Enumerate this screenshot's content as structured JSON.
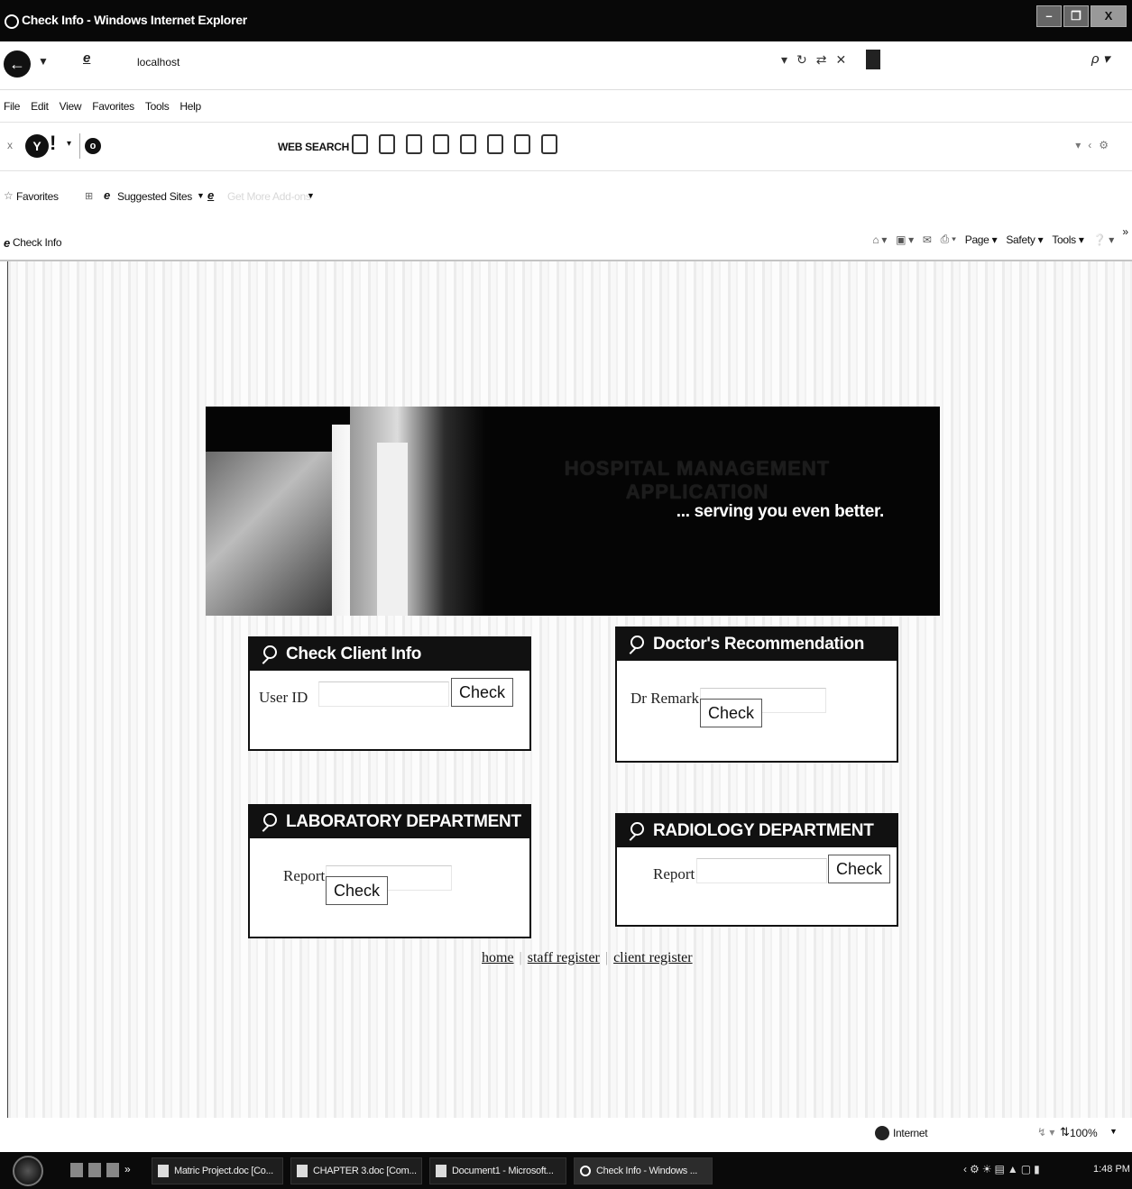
{
  "window": {
    "title": "Check Info - Windows Internet Explorer",
    "minimize_glyph": "–",
    "restore_glyph": "❐",
    "close_glyph": "X"
  },
  "addressbar": {
    "url": "localhost"
  },
  "menu": [
    "File",
    "Edit",
    "View",
    "Favorites",
    "Tools",
    "Help"
  ],
  "toolbar": {
    "websearch_label": "WEB SEARCH"
  },
  "favorites": {
    "favorites_label": "Favorites",
    "suggested_label": "Suggested Sites",
    "webslice_label": "Get More Add-ons"
  },
  "tab": {
    "label": "Check Info"
  },
  "commandbar": {
    "page_label": "Page ▾",
    "safety_label": "Safety ▾",
    "tools_label": "Tools ▾",
    "more_label": "»"
  },
  "banner": {
    "title": "HOSPITAL MANAGEMENT APPLICATION",
    "tagline": "... serving you even better."
  },
  "panels": {
    "client": {
      "title": "Check Client Info",
      "label": "User ID",
      "button": "Check"
    },
    "doctor": {
      "title": "Doctor's Recommendation",
      "label": "Dr Remark",
      "button": "Check"
    },
    "lab": {
      "title": "LABORATORY DEPARTMENT",
      "label": "Report",
      "button": "Check"
    },
    "radiology": {
      "title": "RADIOLOGY DEPARTMENT",
      "label": "Report",
      "button": "Check"
    }
  },
  "links": {
    "home": "home",
    "staff": "staff register",
    "client": "client register"
  },
  "statusbar": {
    "zone": "Internet",
    "zoom": "100%"
  },
  "taskbar": {
    "tasks": [
      "Matric Project.doc [Co...",
      "CHAPTER 3.doc [Com...",
      "Document1 - Microsoft...",
      "Check Info - Windows ..."
    ],
    "clock": "1:48 PM"
  }
}
